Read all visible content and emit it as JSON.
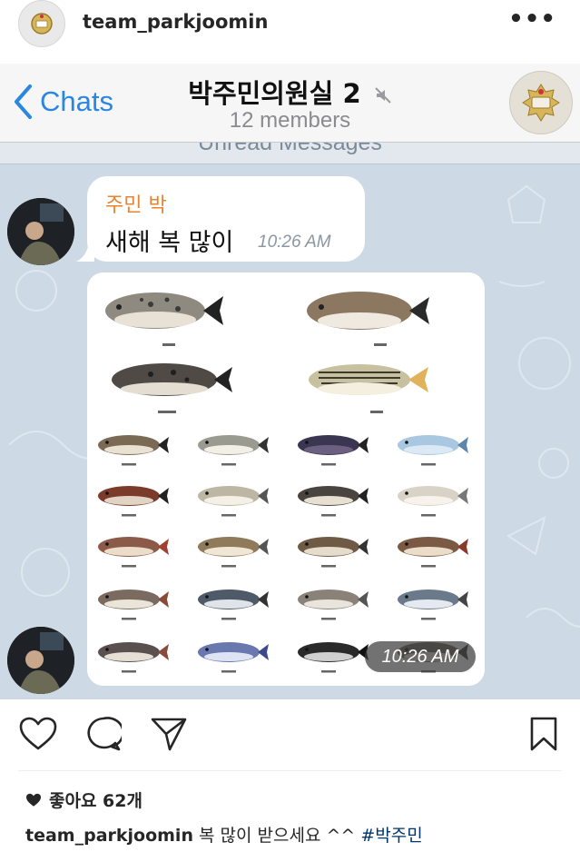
{
  "post": {
    "username": "team_parkjoomin",
    "more_icon": "more-horizontal-icon",
    "likes_label": "좋아요 62개",
    "caption_user": "team_parkjoomin",
    "caption_text": " 복 많이 받으세요 ^^ ",
    "caption_hashtag": "#박주민"
  },
  "telegram": {
    "back_label": "Chats",
    "chat_title": "박주민의원실 2",
    "members": "12 members",
    "unread_label": "Unread Messages",
    "message": {
      "sender": "주민 박",
      "text": "새해 복 많이",
      "time": "10:26 AM"
    },
    "image_message": {
      "time": "10:26 AM"
    },
    "colors": {
      "link": "#2a86de",
      "sender_name": "#e9832f",
      "chat_background": "#cdd9e5"
    }
  }
}
